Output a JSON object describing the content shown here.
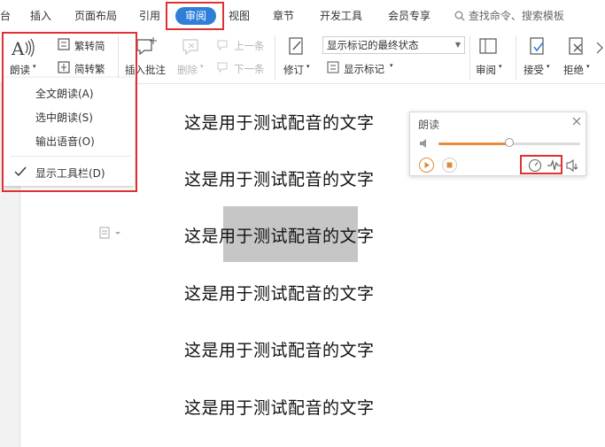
{
  "tabs": [
    {
      "label": "台"
    },
    {
      "label": "插入"
    },
    {
      "label": "页面布局"
    },
    {
      "label": "引用"
    },
    {
      "label": "审阅",
      "active": true
    },
    {
      "label": "视图"
    },
    {
      "label": "章节"
    },
    {
      "label": "开发工具"
    },
    {
      "label": "会员专享"
    }
  ],
  "search": {
    "placeholder": "查找命令、搜索模板"
  },
  "ribbon": {
    "read_aloud": "朗读",
    "trad_to_simp": "繁转简",
    "simp_to_trad": "简转繁",
    "insert_comment": "插入批注",
    "delete": "删除",
    "prev": "上一条",
    "next": "下一条",
    "revise": "修订",
    "markup_state": "显示标记的最终状态",
    "show_markup": "显示标记",
    "review": "审阅",
    "accept": "接受",
    "reject": "拒绝"
  },
  "menu": {
    "items": [
      "全文朗读(A)",
      "选中朗读(S)",
      "输出语音(O)"
    ],
    "toolbar_item": "显示工具栏(D)",
    "toolbar_checked": true
  },
  "document": {
    "lines": [
      "这是用于测试配音的文字",
      "这是用于测试配音的文字",
      "这是用于测试配音的文字",
      "这是用于测试配音的文字",
      "这是用于测试配音的文字",
      "这是用于测试配音的文字"
    ]
  },
  "panel": {
    "title": "朗读",
    "volume_level": 0.5
  },
  "colors": {
    "accent": "#2f7fd8",
    "highlight_box": "#e0312f",
    "orange": "#e88a3c"
  }
}
